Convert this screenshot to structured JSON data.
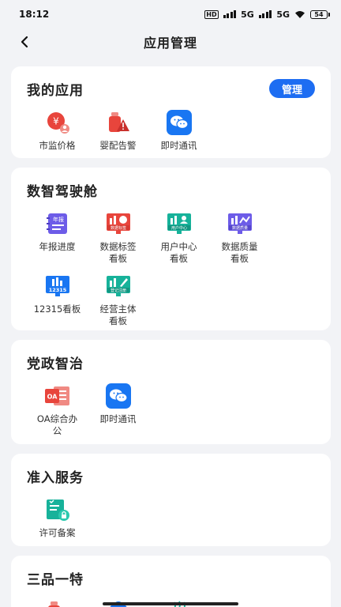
{
  "status": {
    "time": "18:12",
    "net1": "5G",
    "net2": "5G",
    "battery": "54",
    "hd": "HD"
  },
  "nav": {
    "title": "应用管理"
  },
  "sections": {
    "my_apps": {
      "title": "我的应用",
      "manage": "管理",
      "items": [
        "市监价格",
        "婴配告警",
        "即时通讯"
      ]
    },
    "cockpit": {
      "title": "数智驾驶舱",
      "items": [
        {
          "line1": "年报进度",
          "line2": "",
          "icon_text": "年报"
        },
        {
          "line1": "数据标签",
          "line2": "看板",
          "icon_text": "数据标签"
        },
        {
          "line1": "用户中心",
          "line2": "看板",
          "icon_text": "用户中心"
        },
        {
          "line1": "数据质量",
          "line2": "看板",
          "icon_text": "数据质量"
        },
        {
          "line1": "12315看板",
          "line2": "",
          "icon_text": "12315"
        },
        {
          "line1": "经营主体",
          "line2": "看板",
          "icon_text": "登记注册"
        }
      ]
    },
    "party": {
      "title": "党政智治",
      "items": [
        {
          "line1": "OA综合办",
          "line2": "公",
          "icon_text": "OA"
        },
        {
          "line1": "即时通讯",
          "line2": ""
        }
      ]
    },
    "access": {
      "title": "准入服务",
      "items": [
        "许可备案"
      ]
    },
    "special": {
      "title": "三品一特"
    }
  },
  "colors": {
    "accent": "#1d6df2",
    "red": "#e8453c",
    "blue": "#1976f2",
    "teal": "#17b29a",
    "purple": "#6d5ce8"
  }
}
